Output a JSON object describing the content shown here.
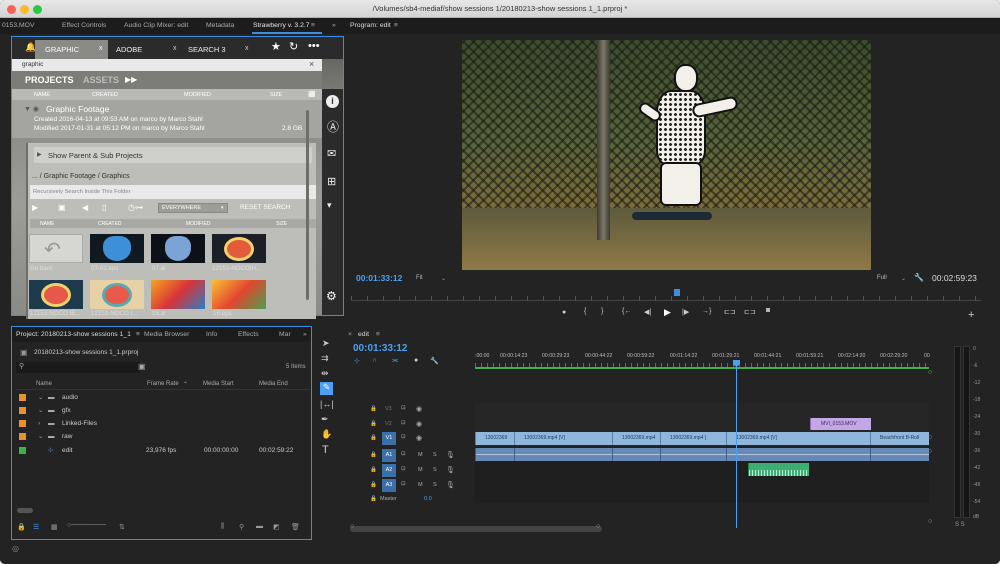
{
  "window": {
    "title": "/Volumes/sb4-mediaf/show sessions 1/20180213-show sessions 1_1.prproj *"
  },
  "top_tabs": {
    "left_cut": "0153.MOV",
    "effect_controls": "Effect Controls",
    "audio_clip_mixer": "Audio Clip Mixer: edit",
    "metadata": "Metadata",
    "strawberry": "Strawberry v. 3.2.7",
    "menu": "≡",
    "overflow": "»"
  },
  "strawberry": {
    "tabs": [
      {
        "label": "GRAPHIC",
        "close": "x"
      },
      {
        "label": "ADOBE",
        "close": "x"
      },
      {
        "label": "SEARCH 3",
        "close": "x"
      }
    ],
    "search_value": "graphic",
    "clear": "×",
    "view_projects": "PROJECTS",
    "view_assets": "ASSETS",
    "view_arrows": "▶▶",
    "columns": {
      "name": "NAME",
      "created": "CREATED",
      "modified": "MODIFIED",
      "size": "SIZE"
    },
    "project": {
      "name": "Graphic Footage",
      "created": "Created  2016-04-13 at 09:53 AM on marco by Marco Stahl",
      "modified": "Modified 2017-01-31 at 05:12 PM on marco by Marco Stahl",
      "size": "2.8 GB"
    },
    "show_parent": "Show Parent & Sub Projects",
    "breadcrumb": "... / Graphic Footage  / Graphics",
    "recursive_placeholder": "Recursively Search Inside This Folder",
    "filter_select": "EVERYWHERE",
    "reset_search": "RESET SEARCH",
    "sub_columns": {
      "name": "NAME",
      "created": "CREATED",
      "modified": "MODIFIED",
      "size": "SIZE"
    },
    "thumbs": [
      {
        "caption": "Go back"
      },
      {
        "caption": "07-01.eps"
      },
      {
        "caption": "07.ai"
      },
      {
        "caption": "12153-NOCOIH..."
      },
      {
        "caption": "12153-NOCO IE..."
      },
      {
        "caption": "12153-NOCO I..."
      },
      {
        "caption": "16.ai"
      },
      {
        "caption": "16.eps"
      }
    ]
  },
  "program": {
    "title": "Program: edit",
    "menu": "≡",
    "timecode": "00:01:33:12",
    "fit": "Fit",
    "quality": "Full",
    "duration": "00:02:59:23",
    "add": "+"
  },
  "project_panel": {
    "tabs": {
      "project": "Project: 20180213-show sessions 1_1",
      "menu": "≡",
      "media_browser": "Media Browser",
      "info": "Info",
      "effects": "Effects",
      "markers": "Mar",
      "overflow": "»"
    },
    "file": "20180213-show sessions 1_1.prproj",
    "items_count": "5 Items",
    "columns": {
      "name": "Name",
      "frame_rate": "Frame Rate",
      "sort": "⌃",
      "media_start": "Media Start",
      "media_end": "Media End"
    },
    "rows": [
      {
        "name": "audio",
        "color": "#e8922c",
        "chev": "⌄"
      },
      {
        "name": "gfx",
        "color": "#e8922c",
        "chev": "⌄"
      },
      {
        "name": "Linked-Files",
        "color": "#e8922c",
        "chev": "›"
      },
      {
        "name": "raw",
        "color": "#e8922c",
        "chev": "⌄"
      },
      {
        "name": "edit",
        "color": "#3fb04a",
        "frame_rate": "23,976 fps",
        "start": "00:00:00:00",
        "end": "00:02:59:22"
      }
    ]
  },
  "timeline": {
    "title": "edit",
    "close": "×",
    "menu": "≡",
    "timecode": "00:01:33:12",
    "ruler": [
      ":00:00",
      "00:00:14:23",
      "00:00:29:23",
      "00:00:44:22",
      "00:00:59:22",
      "00:01:14:22",
      "00:01:29:21",
      "00:01:44:21",
      "00:01:59:21",
      "00:02:14:20",
      "00:02:29:20",
      "00"
    ],
    "tracks": [
      {
        "label": "V3"
      },
      {
        "label": "V2"
      },
      {
        "label": "V1"
      },
      {
        "label": "A1",
        "m": "M",
        "s": "S"
      },
      {
        "label": "A2",
        "m": "M",
        "s": "S"
      },
      {
        "label": "A3",
        "m": "M",
        "s": "S"
      }
    ],
    "master": "Master",
    "master_value": "0.0",
    "v1_clips": [
      "13002369",
      "13002369.mp4 [V]",
      "13002369.mp4",
      "13002369.mp4 [",
      "13002369.mp4 [V]",
      "Beachfront B-Roll"
    ],
    "v2_clip": "MVI_0153.MOV"
  },
  "meter": {
    "ticks": [
      "0",
      "-6",
      "-12",
      "-18",
      "-24",
      "-30",
      "-36",
      "-42",
      "-48",
      "-54",
      "dB"
    ],
    "solo": "S S"
  },
  "colors": {
    "accent": "#3d8ee0",
    "timecode": "#4aa0f5",
    "clip_video": "#8fb6db",
    "clip_purple": "#c3a6e6",
    "audio_green": "#3fae74"
  }
}
